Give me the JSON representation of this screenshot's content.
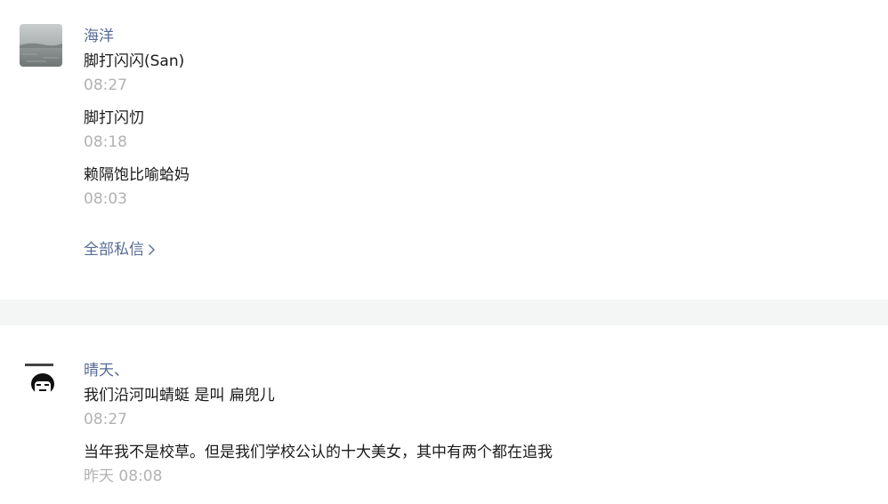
{
  "conversations": [
    {
      "name": "海洋",
      "avatar": "seascape-avatar",
      "messages": [
        {
          "text": "脚打闪闪(San)",
          "time": "08:27"
        },
        {
          "text": "脚打闪忉",
          "time": "08:18"
        },
        {
          "text": "赖隔饱比喻蛤妈",
          "time": "08:03"
        }
      ],
      "all_link": "全部私信"
    },
    {
      "name": "晴天、",
      "avatar": "meme-face-avatar",
      "messages": [
        {
          "text": "我们沿河叫蜻蜓 是叫 扁兜儿",
          "time": "08:27"
        },
        {
          "text": "当年我不是校草。但是我们学校公认的十大美女，其中有两个都在追我",
          "time": "昨天 08:08"
        }
      ]
    }
  ],
  "icons": {
    "chevron": "chevron-right-icon"
  },
  "colors": {
    "name": "#576b95",
    "text": "#1a1a1a",
    "time": "#b2b2b2",
    "separator": "#f4f5f5"
  }
}
